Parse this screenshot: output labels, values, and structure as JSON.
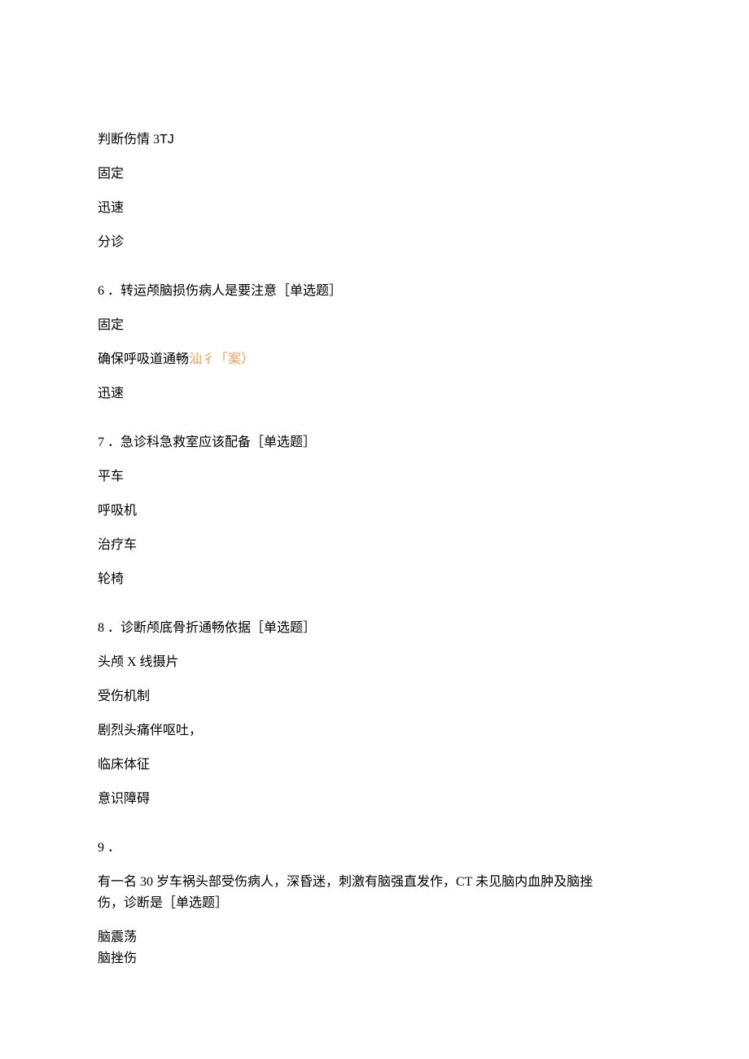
{
  "intro": {
    "line1a": "判断伤情 3",
    "line1b": "TJ",
    "line2": "固定",
    "line3": "迅速",
    "line4": "分诊"
  },
  "q6": {
    "stem": "6 ．转运颅脑损伤病人是要注意［单选题］",
    "opt1": "固定",
    "opt2a": "确保呼吸道通畅",
    "opt2b": "汕彳「案）",
    "opt3": "迅速"
  },
  "q7": {
    "stem": "7 ．急诊科急救室应该配备［单选题］",
    "opt1": "平车",
    "opt2": "呼吸机",
    "opt3": "治疗车",
    "opt4": "轮椅"
  },
  "q8": {
    "stem": "8 ．诊断颅底骨折通畅依据［单选题］",
    "opt1": "头颅 X 线摄片",
    "opt2": "受伤机制",
    "opt3": "剧烈头痛伴呕吐，",
    "opt4": "临床体征",
    "opt5": "意识障碍"
  },
  "q9": {
    "num": "9 ．",
    "stem1": "有一名 30 岁车祸头部受伤病人，深昏迷，刺激有脑强直发作，CT 未见脑内血肿及脑挫",
    "stem2": "伤，诊断是［单选题］",
    "opt1": "脑震荡",
    "opt2": "脑挫伤"
  }
}
